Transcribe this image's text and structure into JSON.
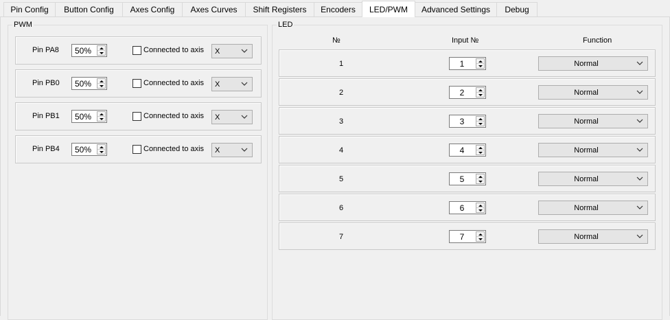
{
  "tabs": [
    {
      "label": "Pin Config",
      "active": false
    },
    {
      "label": "Button Config",
      "active": false
    },
    {
      "label": "Axes Config",
      "active": false
    },
    {
      "label": "Axes Curves",
      "active": false
    },
    {
      "label": "Shift Registers",
      "active": false
    },
    {
      "label": "Encoders",
      "active": false
    },
    {
      "label": "LED/PWM",
      "active": true
    },
    {
      "label": "Advanced Settings",
      "active": false
    },
    {
      "label": "Debug",
      "active": false
    }
  ],
  "pwm": {
    "title": "PWM",
    "rows": [
      {
        "pin": "Pin PA8",
        "value": "50%",
        "connected_label": "Connected to axis",
        "checked": false,
        "axis": "X"
      },
      {
        "pin": "Pin PB0",
        "value": "50%",
        "connected_label": "Connected to axis",
        "checked": false,
        "axis": "X"
      },
      {
        "pin": "Pin PB1",
        "value": "50%",
        "connected_label": "Connected to axis",
        "checked": false,
        "axis": "X"
      },
      {
        "pin": "Pin PB4",
        "value": "50%",
        "connected_label": "Connected to axis",
        "checked": false,
        "axis": "X"
      }
    ]
  },
  "led": {
    "title": "LED",
    "headers": {
      "num": "№",
      "input": "Input №",
      "function": "Function"
    },
    "rows": [
      {
        "num": "1",
        "input": "1",
        "function": "Normal"
      },
      {
        "num": "2",
        "input": "2",
        "function": "Normal"
      },
      {
        "num": "3",
        "input": "3",
        "function": "Normal"
      },
      {
        "num": "4",
        "input": "4",
        "function": "Normal"
      },
      {
        "num": "5",
        "input": "5",
        "function": "Normal"
      },
      {
        "num": "6",
        "input": "6",
        "function": "Normal"
      },
      {
        "num": "7",
        "input": "7",
        "function": "Normal"
      }
    ]
  },
  "colors": {
    "page_bg": "#f0f0f0",
    "combo_bg": "#e5e5e5",
    "border": "#c9c9c9"
  }
}
